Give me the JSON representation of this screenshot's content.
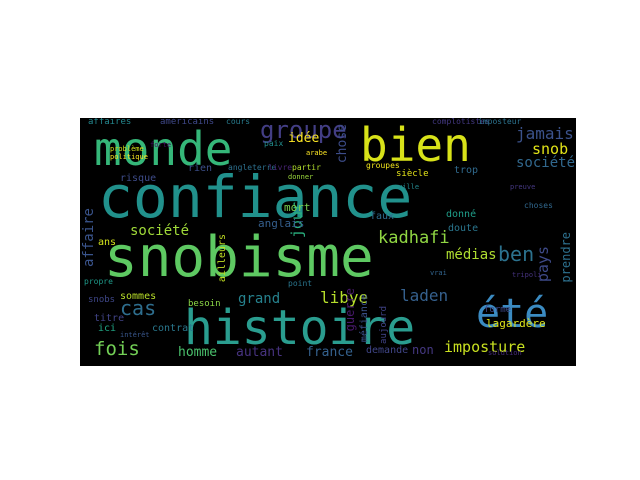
{
  "words": [
    {
      "text": "confiance",
      "color": "#21918c"
    },
    {
      "text": "snobisme",
      "color": "#5ec962"
    },
    {
      "text": "histoire",
      "color": "#2a9d8f"
    },
    {
      "text": "monde",
      "color": "#35b779"
    },
    {
      "text": "bien",
      "color": "#d8e219"
    },
    {
      "text": "été",
      "color": "#3b8bc2"
    },
    {
      "text": "groupe",
      "color": "#433e85"
    },
    {
      "text": "jamais",
      "color": "#3b528b"
    },
    {
      "text": "snob",
      "color": "#e2e418"
    },
    {
      "text": "sociétés",
      "color": "#31688e"
    },
    {
      "text": "ben",
      "color": "#2c728e"
    },
    {
      "text": "pays",
      "color": "#3e4a89"
    },
    {
      "text": "kadhafi",
      "color": "#90d743"
    },
    {
      "text": "médias",
      "color": "#addc30"
    },
    {
      "text": "laden",
      "color": "#35608d"
    },
    {
      "text": "libye",
      "color": "#b5de2b"
    },
    {
      "text": "imposture",
      "color": "#c8e020"
    },
    {
      "text": "cas",
      "color": "#2e6e8e"
    },
    {
      "text": "fois",
      "color": "#73d056"
    },
    {
      "text": "société",
      "color": "#a0da39"
    },
    {
      "text": "affaire",
      "color": "#3a548c"
    },
    {
      "text": "homme",
      "color": "#4ac16d"
    },
    {
      "text": "autant",
      "color": "#46327e"
    },
    {
      "text": "france",
      "color": "#34618d"
    },
    {
      "text": "grand",
      "color": "#26828e"
    },
    {
      "text": "idée",
      "color": "#fde725"
    },
    {
      "text": "jour",
      "color": "#2ab07f"
    },
    {
      "text": "chose",
      "color": "#3d4d8a"
    },
    {
      "text": "risque",
      "color": "#3e4c8a"
    },
    {
      "text": "mort",
      "color": "#7ad151"
    },
    {
      "text": "anglais",
      "color": "#355f8d"
    },
    {
      "text": "guerre",
      "color": "#48196b"
    },
    {
      "text": "méfiance",
      "color": "#3b528b"
    },
    {
      "text": "lagardère",
      "color": "#dde318"
    },
    {
      "text": "prendre",
      "color": "#2d708e"
    },
    {
      "text": "forme",
      "color": "#3e4989"
    },
    {
      "text": "non",
      "color": "#453882"
    },
    {
      "text": "demande",
      "color": "#404688"
    },
    {
      "text": "contrat",
      "color": "#2a788e"
    },
    {
      "text": "titre",
      "color": "#414487"
    },
    {
      "text": "ici",
      "color": "#21a685"
    },
    {
      "text": "sommes",
      "color": "#b8de29"
    },
    {
      "text": "snobs",
      "color": "#3f4788"
    },
    {
      "text": "besoin",
      "color": "#8bd646"
    },
    {
      "text": "rien",
      "color": "#3c4f8a"
    },
    {
      "text": "ans",
      "color": "#d2e21b"
    },
    {
      "text": "faux",
      "color": "#2f6c8e"
    },
    {
      "text": "trop",
      "color": "#306a8e"
    },
    {
      "text": "donné",
      "color": "#1f9e89"
    },
    {
      "text": "doute",
      "color": "#2a768e"
    },
    {
      "text": "aujourd",
      "color": "#404387"
    },
    {
      "text": "ailleurs",
      "color": "#c2df23"
    },
    {
      "text": "américains",
      "color": "#3f4889"
    },
    {
      "text": "affaires",
      "color": "#24878e"
    },
    {
      "text": "siècle",
      "color": "#e5e419"
    },
    {
      "text": "groupes",
      "color": "#f1e51d"
    },
    {
      "text": "complotistes",
      "color": "#443983"
    },
    {
      "text": "imposteur",
      "color": "#2c738e"
    },
    {
      "text": "question",
      "color": "#fde725"
    },
    {
      "text": "cours",
      "color": "#287c8e"
    },
    {
      "text": "angleterre",
      "color": "#2d708e"
    },
    {
      "text": "livre",
      "color": "#482475"
    },
    {
      "text": "partir",
      "color": "#b2dd2d"
    },
    {
      "text": "paix",
      "color": "#228d8d"
    },
    {
      "text": "choses",
      "color": "#31688e"
    },
    {
      "text": "point",
      "color": "#2a768e"
    },
    {
      "text": "propre",
      "color": "#1f9a8a"
    },
    {
      "text": "politique",
      "color": "#f8e621"
    },
    {
      "text": "problème",
      "color": "#d0e11c"
    },
    {
      "text": "forte",
      "color": "#471063"
    },
    {
      "text": "solution",
      "color": "#472c7a"
    },
    {
      "text": "ville",
      "color": "#24878e"
    },
    {
      "text": "tripoli",
      "color": "#46337f"
    },
    {
      "text": "preuve",
      "color": "#453882"
    },
    {
      "text": "vrai",
      "color": "#32658e"
    },
    {
      "text": "intérêt",
      "color": "#39568c"
    },
    {
      "text": "arabe",
      "color": "#fde725"
    },
    {
      "text": "donner",
      "color": "#9bd93c"
    }
  ]
}
